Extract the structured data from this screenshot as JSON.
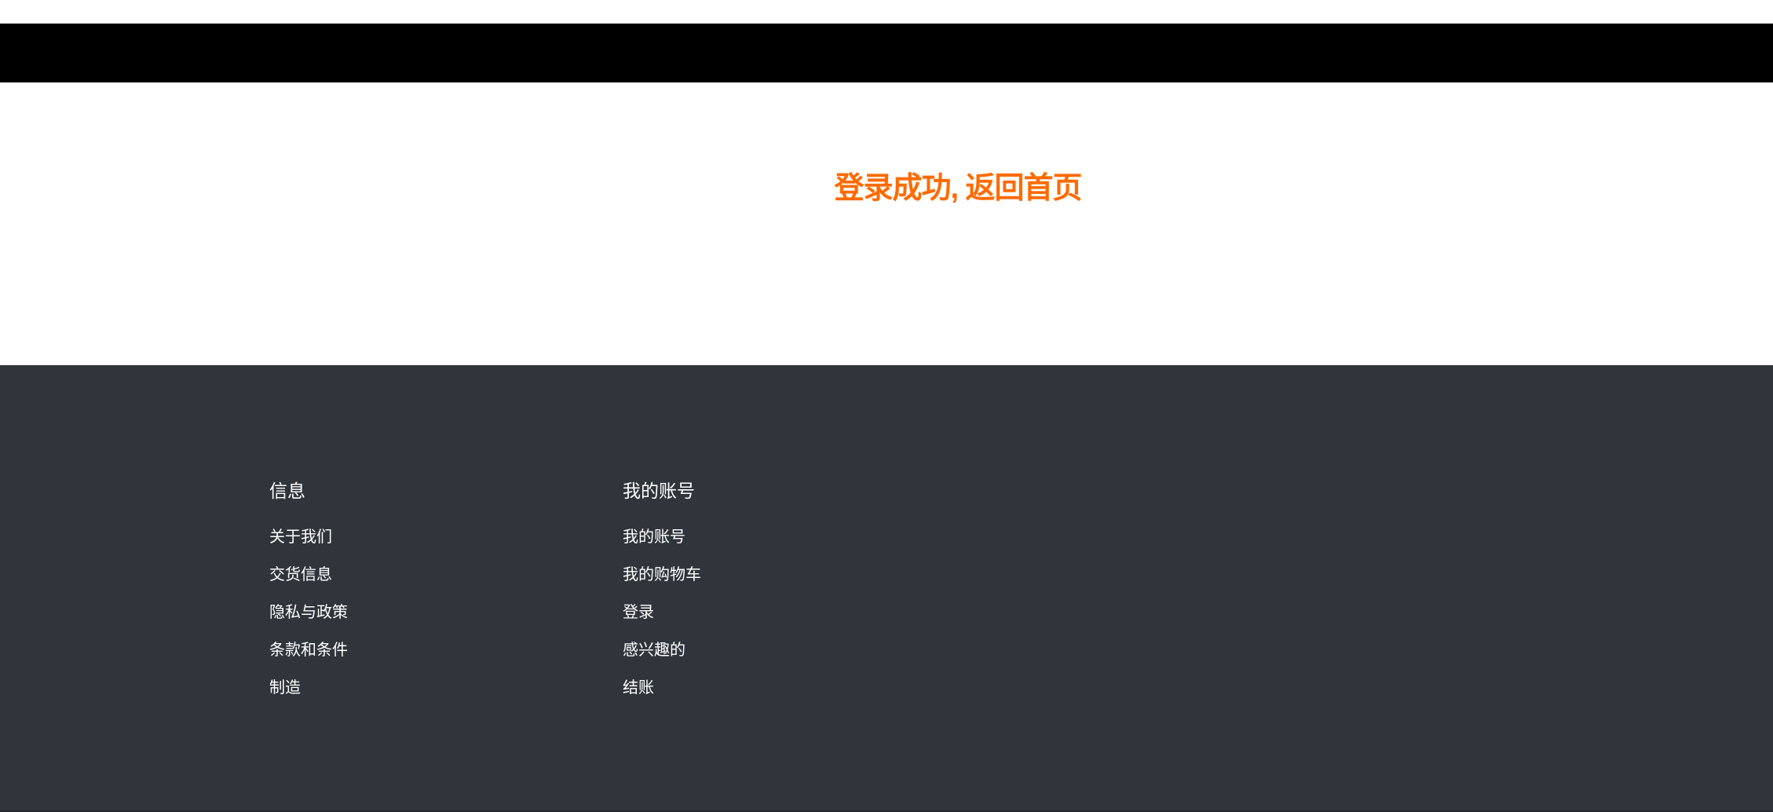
{
  "main": {
    "success_message": "登录成功, 返回首页"
  },
  "footer": {
    "columns": [
      {
        "heading": "信息",
        "links": [
          "关于我们",
          "交货信息",
          "隐私与政策",
          "条款和条件",
          "制造"
        ]
      },
      {
        "heading": "我的账号",
        "links": [
          "我的账号",
          "我的购物车",
          "登录",
          "感兴趣的",
          "结账"
        ]
      }
    ]
  },
  "colors": {
    "accent": "#ff6a00",
    "header_bg": "#000000",
    "footer_bg": "#30343b",
    "footer_text": "#ffffff"
  }
}
